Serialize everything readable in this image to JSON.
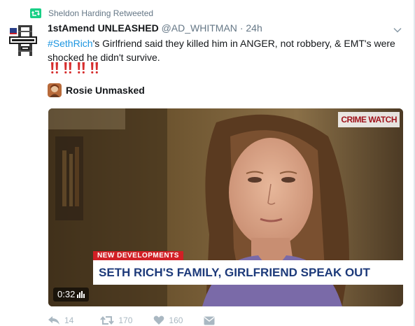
{
  "context": {
    "retweeted_by": "Sheldon Harding Retweeted"
  },
  "author": {
    "display_name": "1stAmend UNLEASHED",
    "handle": "@AD_WHITMAN",
    "separator": "·",
    "time": "24h"
  },
  "tweet": {
    "hashtag": "#SethRich",
    "text_rest": "'s Girlfriend said they killed him in ANGER, not robbery, & EMT's were shocked he didn't survive.",
    "emoji_count": 4,
    "emoji_name": "double-exclamation-icon"
  },
  "card": {
    "author_name": "Rosie Unmasked",
    "video": {
      "logo": "CRIME WATCH",
      "tag": "NEW DEVELOPMENTS",
      "headline": "SETH RICH'S FAMILY, GIRLFRIEND SPEAK OUT",
      "duration": "0:32"
    }
  },
  "actions": {
    "reply_count": "14",
    "retweet_count": "170",
    "like_count": "160"
  },
  "colors": {
    "link": "#1b95e0",
    "retweet_green": "#19cf86",
    "muted": "#657786",
    "action_gray": "#aab8c2",
    "news_red": "#d21f25",
    "news_blue": "#1d3a7a"
  }
}
